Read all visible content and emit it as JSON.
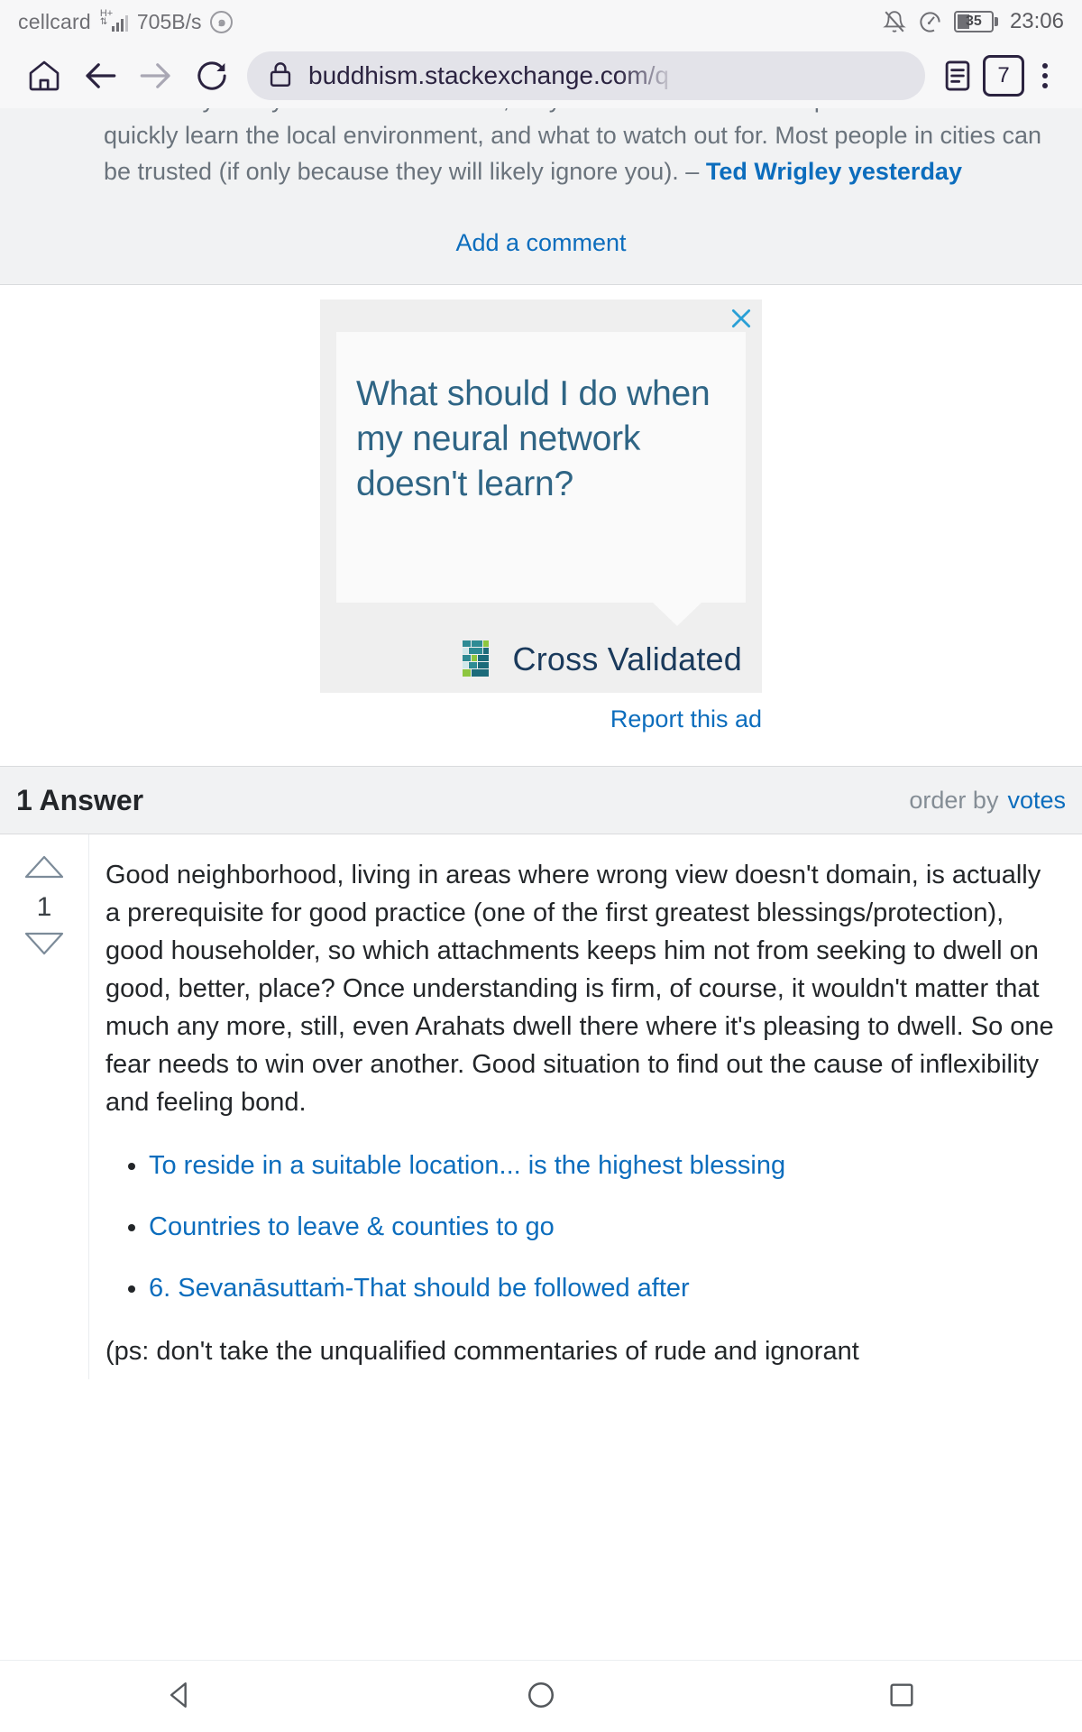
{
  "statusbar": {
    "carrier": "cellcard",
    "network_type": "H+",
    "speed": "705B/s",
    "datasaver_icon": "data-saver-icon",
    "mute_icon": "bell-muted-icon",
    "dnd_icon": "speedometer-icon",
    "battery_level": "35",
    "clock": "23:06"
  },
  "toolbar": {
    "home_icon": "home-icon",
    "back_icon": "arrow-back-icon",
    "forward_icon": "arrow-forward-icon",
    "reload_icon": "reload-icon",
    "lock_icon": "lock-icon",
    "url": "buddhism.stackexchange.com/q",
    "reader_icon": "reader-mode-icon",
    "tab_count": "7",
    "menu_icon": "kebab-menu-icon"
  },
  "comment": {
    "line_cut": "come stay with you for a week or two, so you have someone to explore with. You'll",
    "text": "quickly learn the local environment, and what to watch out for. Most people in cities can be trusted (if only because they will likely ignore you). – ",
    "author": "Ted Wrigley",
    "date": "yesterday",
    "add_comment": "Add a comment"
  },
  "ad": {
    "close_icon": "close-icon",
    "headline": "What should I do when my neural network doesn't learn?",
    "brand": "Cross Validated",
    "brand_logo_icon": "cross-validated-logo-icon",
    "report": "Report this ad"
  },
  "answers": {
    "header": "1 Answer",
    "order_by_label": "order by",
    "order_by_value": "votes",
    "upvote_icon": "arrow-up-triangle-icon",
    "downvote_icon": "arrow-down-triangle-icon",
    "vote_count": "1",
    "body": "Good neighborhood, living in areas where wrong view doesn't domain, is actually a prerequisite for good practice (one of the first greatest blessings/protection), good householder, so which attachments keeps him not from seeking to dwell on good, better, place? Once understanding is firm, of course, it wouldn't matter that much any more, still, even Arahats dwell there where it's pleasing to dwell. So one fear needs to win over another. Good situation to find out the cause of inflexibility and feeling bond.",
    "links": [
      "To reside in a suitable location... is the highest blessing",
      "Countries to leave & counties to go",
      "6. Sevanāsuttaṁ-That should be followed after"
    ],
    "ps": "(ps: don't take the unqualified commentaries of rude and ignorant"
  },
  "navbar": {
    "back_icon": "nav-back-triangle-icon",
    "home_icon": "nav-home-circle-icon",
    "recents_icon": "nav-recents-square-icon"
  },
  "colors": {
    "link": "#0c6dbd",
    "text": "#232629",
    "muted": "#848d95",
    "chrome_bg": "#f7f7f8",
    "chrome_fg": "#2b2340",
    "ad_headline": "#2f6585"
  }
}
